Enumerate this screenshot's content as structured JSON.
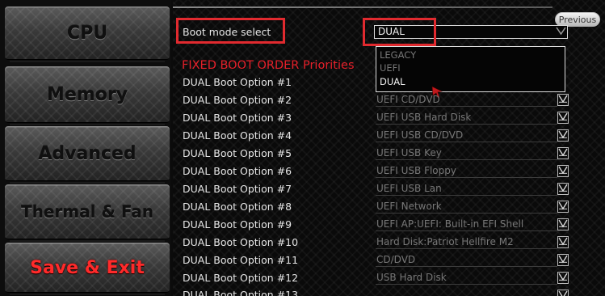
{
  "sidebar": {
    "items": [
      {
        "label": "CPU"
      },
      {
        "label": "Memory"
      },
      {
        "label": "Advanced"
      },
      {
        "label": "Thermal & Fan"
      },
      {
        "label": "Save & Exit"
      }
    ],
    "active_item": "Save & Exit"
  },
  "header": {
    "previous_label": "Previous"
  },
  "boot_mode": {
    "label": "Boot mode select",
    "value": "DUAL",
    "options": [
      "LEGACY",
      "UEFI",
      "DUAL"
    ]
  },
  "section_title": "FIXED BOOT ORDER Priorities",
  "boot_options": [
    {
      "label": "DUAL Boot Option #1",
      "value": ""
    },
    {
      "label": "DUAL Boot Option #2",
      "value": "UEFI CD/DVD"
    },
    {
      "label": "DUAL Boot Option #3",
      "value": "UEFI USB Hard Disk"
    },
    {
      "label": "DUAL Boot Option #4",
      "value": "UEFI USB CD/DVD"
    },
    {
      "label": "DUAL Boot Option #5",
      "value": "UEFI USB Key"
    },
    {
      "label": "DUAL Boot Option #6",
      "value": "UEFI USB Floppy"
    },
    {
      "label": "DUAL Boot Option #7",
      "value": "UEFI USB Lan"
    },
    {
      "label": "DUAL Boot Option #8",
      "value": "UEFI Network"
    },
    {
      "label": "DUAL Boot Option #9",
      "value": "UEFI AP:UEFI: Built-in EFI Shell"
    },
    {
      "label": "DUAL Boot Option #10",
      "value": "Hard Disk:Patriot Hellfire M2"
    },
    {
      "label": "DUAL Boot Option #11",
      "value": "CD/DVD"
    },
    {
      "label": "DUAL Boot Option #12",
      "value": "USB Hard Disk"
    },
    {
      "label": "DUAL Boot Option #13",
      "value": ""
    }
  ],
  "icons": {
    "dropdown_chevron": "chevron-down-icon",
    "mouse_cursor": "mouse-pointer-icon"
  },
  "colors": {
    "accent_red": "#e12a2f",
    "section_title_red": "#e5202a",
    "active_sidebar_red": "#ff2a2a",
    "dimmed_value": "#777777"
  }
}
